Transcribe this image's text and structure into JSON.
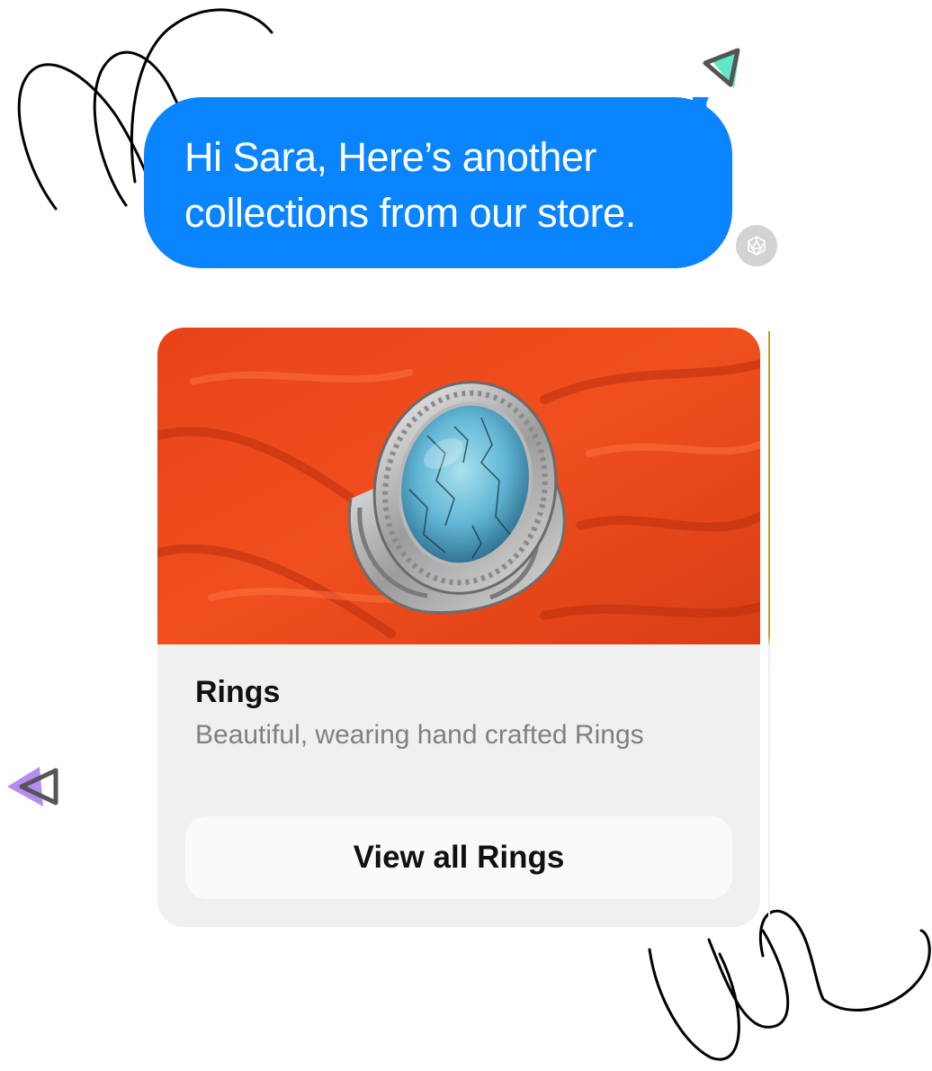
{
  "message": {
    "text": "Hi Sara, Here’s another\ncollections from our store.",
    "bubble_color": "#0a84ff",
    "text_color": "#ffffff"
  },
  "avatar": {
    "icon": "polyhedron-icon"
  },
  "card": {
    "image_alt": "Silver ring with oval turquoise stone on red fabric",
    "title": "Rings",
    "subtitle": "Beautiful, wearing hand crafted Rings",
    "button_label": "View all Rings",
    "background": "#f0f0f0"
  },
  "decorations": {
    "triangle_teal": "#5ee8c9",
    "triangle_purple": "#b58cf0",
    "stroke": "#555555"
  }
}
